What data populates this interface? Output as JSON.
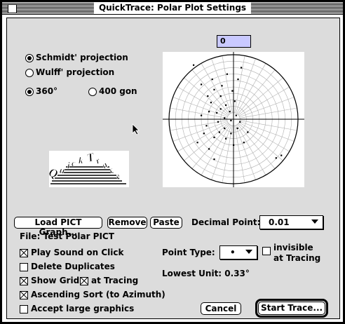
{
  "window": {
    "title": "QuickTrace: Polar Plot Settings"
  },
  "projection": {
    "schmidt_label": "Schmidt' projection",
    "wulff_label": "Wulff' projection",
    "selected": "schmidt"
  },
  "angle_units": {
    "deg_label": "360°",
    "gon_label": "400 gon",
    "selected": "360"
  },
  "rotation_field": {
    "value": "0"
  },
  "logo": {
    "text": "QuickTrace"
  },
  "buttons": {
    "load_pict": "Load PICT Graph...",
    "remove": "Remove",
    "paste": "Paste",
    "cancel": "Cancel",
    "start_trace": "Start Trace..."
  },
  "file": {
    "label": "File: Test Polar PICT"
  },
  "decimal_point": {
    "label": "Decimal Point:",
    "value": "0.01"
  },
  "point_type": {
    "label": "Point Type:",
    "value": "•"
  },
  "invisible_tracing": {
    "label_line1": "invisible",
    "label_line2": "at Tracing",
    "checked": false
  },
  "lowest_unit": {
    "label": "Lowest Unit: 0.33°"
  },
  "options": {
    "play_sound": {
      "label": "Play Sound on Click",
      "checked": true
    },
    "delete_duplicates": {
      "label": "Delete Duplicates",
      "checked": false
    },
    "show_grid": {
      "label": "Show Grid",
      "checked": true
    },
    "grid_at_tracing": {
      "label": "at Tracing",
      "checked": true
    },
    "ascending_sort": {
      "label": "Ascending Sort (to Azimuth)",
      "checked": true
    },
    "accept_large": {
      "label": "Accept large graphics",
      "checked": false
    }
  },
  "plot_points": [
    [
      -0.62,
      0.84
    ],
    [
      -0.5,
      0.54
    ],
    [
      -0.33,
      0.62
    ],
    [
      -0.18,
      0.52
    ],
    [
      -0.1,
      0.7
    ],
    [
      0.12,
      0.8
    ],
    [
      0.07,
      0.62
    ],
    [
      -0.4,
      0.36
    ],
    [
      -0.3,
      0.46
    ],
    [
      -0.2,
      0.36
    ],
    [
      -0.12,
      0.22
    ],
    [
      -0.02,
      0.44
    ],
    [
      0.02,
      0.28
    ],
    [
      -0.35,
      0.26
    ],
    [
      -0.26,
      0.1
    ],
    [
      -0.14,
      0.02
    ],
    [
      -0.04,
      -0.02
    ],
    [
      0.04,
      0.06
    ],
    [
      -0.24,
      -0.04
    ],
    [
      -0.38,
      0.12
    ],
    [
      -0.5,
      0.06
    ],
    [
      -0.14,
      -0.14
    ],
    [
      -0.22,
      -0.2
    ],
    [
      -0.3,
      -0.28
    ],
    [
      -0.04,
      -0.22
    ],
    [
      0.06,
      -0.14
    ],
    [
      0.1,
      -0.04
    ],
    [
      0.22,
      -0.2
    ],
    [
      -0.46,
      -0.22
    ],
    [
      -0.56,
      -0.36
    ],
    [
      -0.38,
      -0.46
    ],
    [
      -0.3,
      -0.62
    ],
    [
      0.16,
      -0.36
    ],
    [
      0.66,
      -0.6
    ],
    [
      0.74,
      -0.56
    ],
    [
      -0.2,
      0.16
    ],
    [
      -0.06,
      0.12
    ],
    [
      -0.12,
      -0.3
    ],
    [
      0.0,
      -0.4
    ],
    [
      -0.42,
      -0.1
    ]
  ]
}
